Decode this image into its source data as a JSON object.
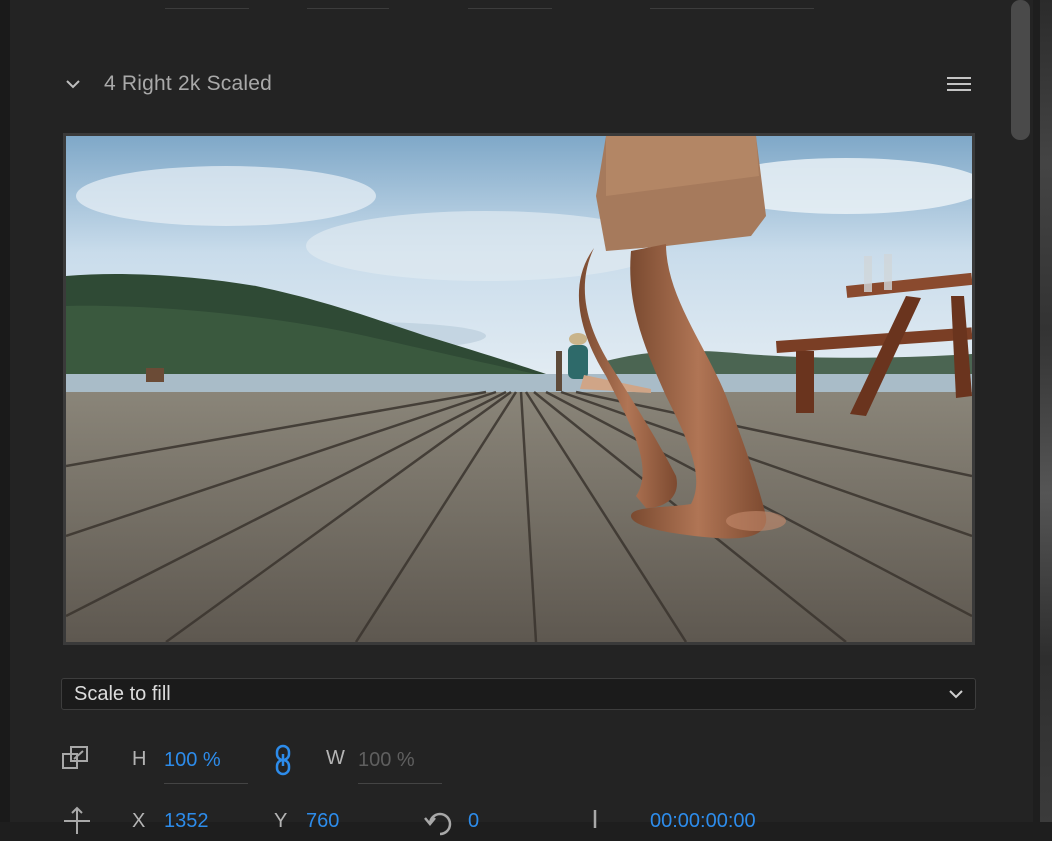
{
  "clip": {
    "title": "4 Right 2k Scaled"
  },
  "preview": {
    "description": "video frame preview"
  },
  "scale_mode": {
    "selected": "Scale to fill"
  },
  "size_row": {
    "h_label": "H",
    "h_value": "100 %",
    "w_label": "W",
    "w_value": "100 %"
  },
  "position_row": {
    "x_label": "X",
    "x_value": "1352",
    "y_label": "Y",
    "y_value": "760",
    "rotation_value": "0",
    "timecode": "00:00:00:00"
  },
  "colors": {
    "accent": "#2d8ceb",
    "panel_bg": "#232323"
  }
}
